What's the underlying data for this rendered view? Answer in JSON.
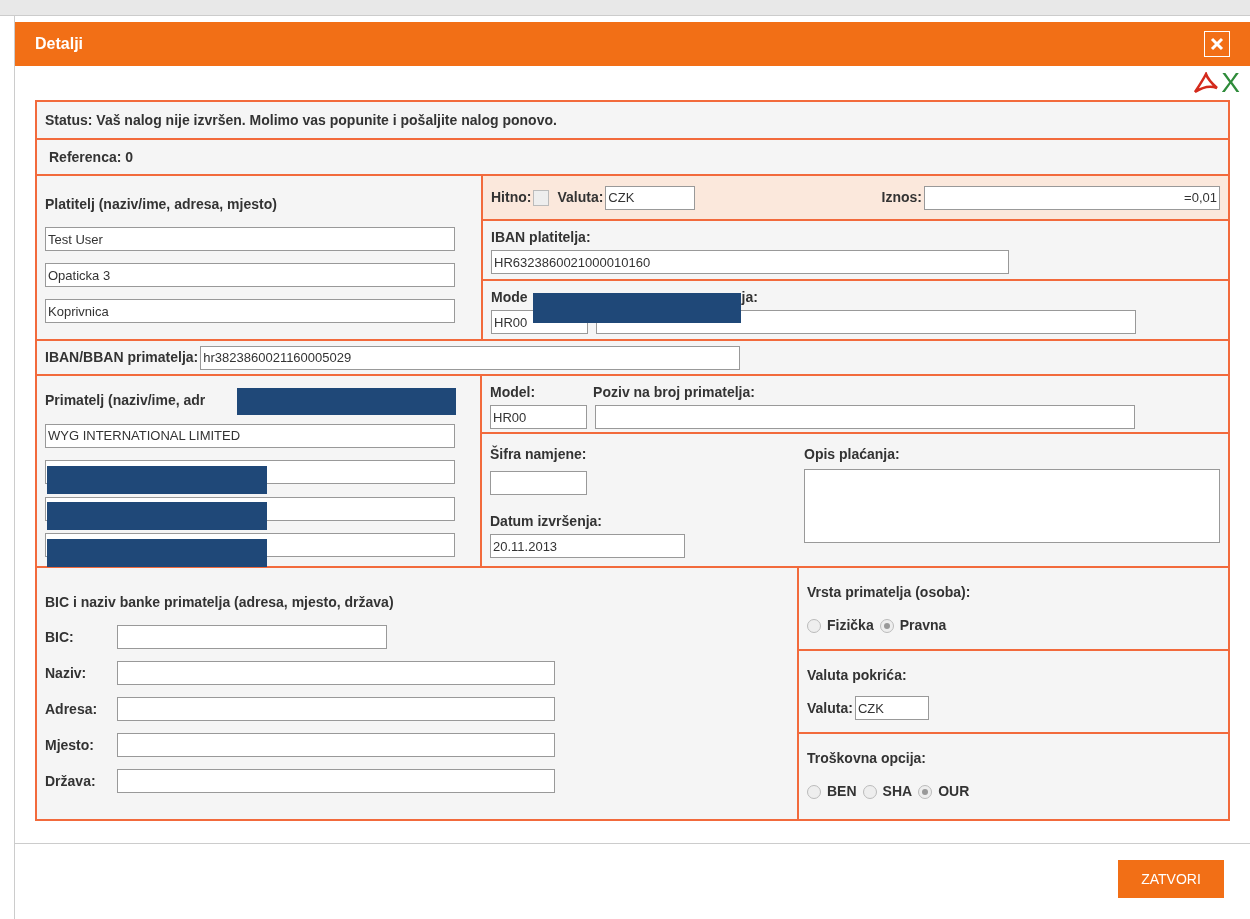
{
  "dialog": {
    "title": "Detalji"
  },
  "export": {
    "excel_label": "X"
  },
  "status": "Status: Vaš nalog nije izvršen. Molimo vas popunite i pošaljite nalog ponovo.",
  "reference": "Referenca: 0",
  "payer": {
    "title": "Platitelj (naziv/ime, adresa, mjesto)",
    "fields": [
      "Test User",
      "Opaticka 3",
      "Koprivnica"
    ]
  },
  "urgent": {
    "label": "Hitno:",
    "checked": false
  },
  "currency": {
    "label": "Valuta:",
    "value": "CZK"
  },
  "amount": {
    "label": "Iznos:",
    "value": "=0,01"
  },
  "payer_iban": {
    "label": "IBAN platitelja:",
    "value": "HR6323860021000010160"
  },
  "payer_reference": {
    "label_start": "Mode",
    "label_end": "ja:",
    "model_value": "HR00"
  },
  "recipient_iban": {
    "label": "IBAN/BBAN primatelja:",
    "value": "hr3823860021160005029"
  },
  "recipient": {
    "title": "Primatelj (naziv/ime, adr",
    "fields": [
      {
        "value": "WYG INTERNATIONAL LIMITED",
        "redacted": false
      },
      {
        "redacted": true
      },
      {
        "redacted": true
      },
      {
        "redacted": true
      }
    ]
  },
  "recipient_reference": {
    "model_label": "Model:",
    "model_value": "HR00",
    "reference_label": "Poziv na broj primatelja:"
  },
  "purpose_code": {
    "label": "Šifra namjene:"
  },
  "execution_date": {
    "label": "Datum izvršenja:",
    "value": "20.11.2013"
  },
  "description": {
    "label": "Opis plaćanja:"
  },
  "bank": {
    "title": "BIC i naziv banke primatelja (adresa, mjesto, država)",
    "fields": [
      {
        "label": "BIC:",
        "kind": "short"
      },
      {
        "label": "Naziv:",
        "kind": "long"
      },
      {
        "label": "Adresa:",
        "kind": "long"
      },
      {
        "label": "Mjesto:",
        "kind": "long"
      },
      {
        "label": "Država:",
        "kind": "long"
      }
    ]
  },
  "recipient_type": {
    "title": "Vrsta primatelja (osoba):",
    "options": [
      {
        "label": "Fizička",
        "selected": false
      },
      {
        "label": "Pravna",
        "selected": true
      }
    ]
  },
  "cover_currency": {
    "title": "Valuta pokrića:",
    "label": "Valuta:",
    "value": "CZK"
  },
  "cost_option": {
    "title": "Troškovna opcija:",
    "options": [
      {
        "label": "BEN",
        "selected": false
      },
      {
        "label": "SHA",
        "selected": false
      },
      {
        "label": "OUR",
        "selected": true
      }
    ]
  },
  "close_button": "ZATVORI"
}
